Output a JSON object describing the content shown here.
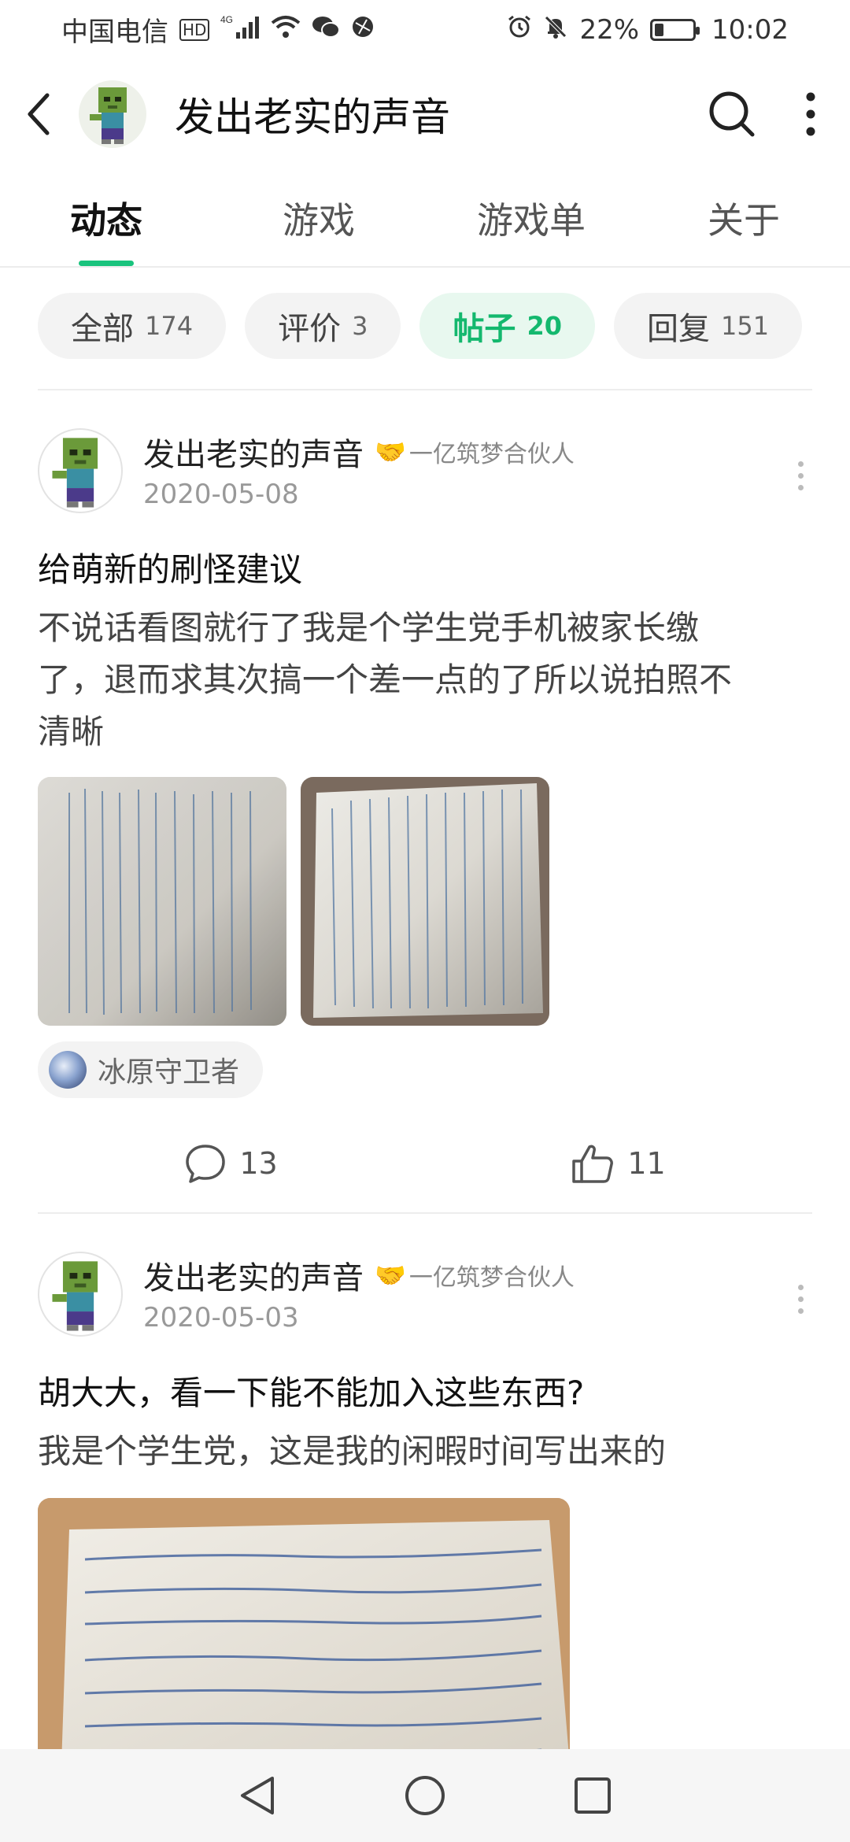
{
  "status_bar": {
    "carrier": "中国电信",
    "network_badges": [
      "HD",
      "4G"
    ],
    "battery": "22%",
    "battery_level": 0.22,
    "time": "10:02",
    "icons": [
      "signal-icon",
      "wifi-icon",
      "wechat-icon",
      "app-notify-icon",
      "alarm-icon",
      "mute-icon",
      "battery-icon"
    ]
  },
  "header": {
    "title": "发出老实的声音",
    "back_icon": "back-arrow-icon",
    "search_icon": "search-icon",
    "more_icon": "more-vertical-icon"
  },
  "tabs": [
    {
      "label": "动态",
      "active": true
    },
    {
      "label": "游戏",
      "active": false
    },
    {
      "label": "游戏单",
      "active": false
    },
    {
      "label": "关于",
      "active": false
    }
  ],
  "filters": [
    {
      "label": "全部",
      "count": "174",
      "active": false
    },
    {
      "label": "评价",
      "count": "3",
      "active": false
    },
    {
      "label": "帖子",
      "count": "20",
      "active": true
    },
    {
      "label": "回复",
      "count": "151",
      "active": false
    }
  ],
  "posts": [
    {
      "author": "发出老实的声音",
      "badge": "一亿筑梦合伙人",
      "date": "2020-05-08",
      "title": "给萌新的刷怪建议",
      "body_lines": [
        "不说话看图就行了我是个学生党手机被家长缴",
        "了，退而求其次搞一个差一点的了所以说拍照不",
        "清晰"
      ],
      "topic": "冰原守卫者",
      "comments": "13",
      "likes": "11"
    },
    {
      "author": "发出老实的声音",
      "badge": "一亿筑梦合伙人",
      "date": "2020-05-03",
      "title": "胡大大，看一下能不能加入这些东西?",
      "body_lines": [
        "我是个学生党，这是我的闲暇时间写出来的"
      ]
    }
  ],
  "colors": {
    "accent": "#19c37d",
    "chip_active_bg": "#e8f8ef"
  }
}
